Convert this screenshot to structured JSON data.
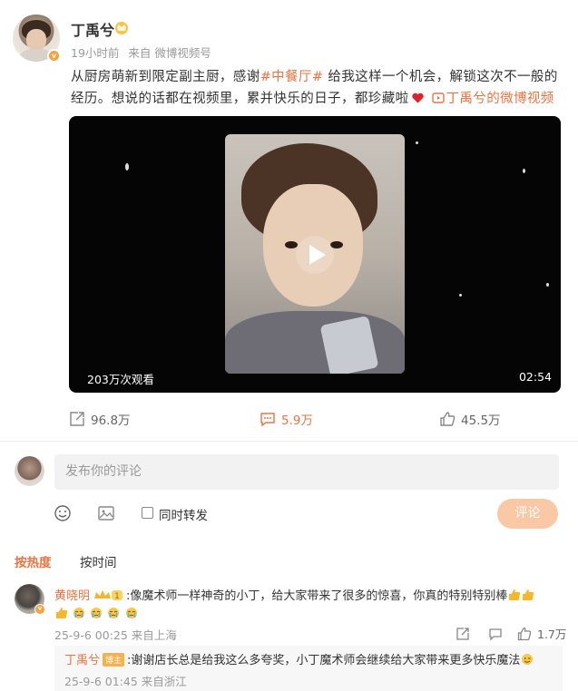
{
  "post": {
    "author": "丁禹兮",
    "time": "19小时前",
    "source": "来自 微博视频号",
    "text_part1": "从厨房萌新到限定副主厨，感谢",
    "hashtag": "#中餐厅#",
    "text_part2": " 给我这样一个机会，解锁这次不一般的经历。想说的话都在视频里，累并快乐的日子，都珍藏啦",
    "video_link": "丁禹兮的微博视频"
  },
  "video": {
    "views": "203万次观看",
    "duration": "02:54"
  },
  "actions": {
    "repost": "96.8万",
    "comment": "5.9万",
    "like": "45.5万"
  },
  "composer": {
    "placeholder": "发布你的评论",
    "repost_label": "同时转发",
    "submit": "评论"
  },
  "sort": {
    "hot": "按热度",
    "time": "按时间"
  },
  "comments": [
    {
      "name": "黄晓明",
      "text1": ":像魔术师一样神奇的小丁，给大家带来了很多的惊喜，你真的特别特别棒",
      "meta": "25-9-6 00:25 来自上海",
      "likes": "1.7万",
      "reply": {
        "name": "丁禹兮",
        "badge": "博主",
        "text": ":谢谢店长总是给我这么多夸奖，小丁魔术师会继续给大家带来更多快乐魔法",
        "meta": "25-9-6 01:45 来自浙江"
      }
    }
  ],
  "colors": {
    "accent": "#eb7340",
    "submit_disabled": "#fbc8a6"
  }
}
